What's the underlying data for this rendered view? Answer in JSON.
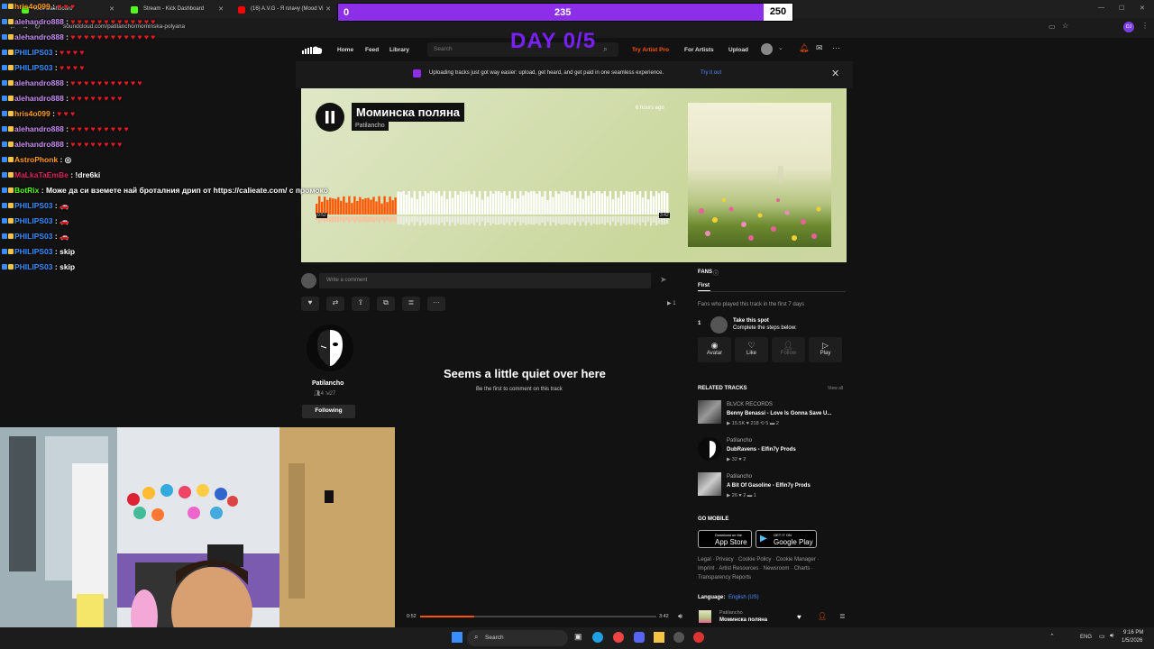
{
  "browser": {
    "tabs": [
      {
        "label": "Kick Dashboard",
        "color": "#53fc18"
      },
      {
        "label": "Stream - Kick Dashboard",
        "color": "#53fc18"
      },
      {
        "label": "(16) A.V.G - Я плачу (Mood Vi",
        "color": "#ff0000"
      }
    ],
    "url": "soundcloud.com/patilancho/mominska-polyana",
    "profile_initials": "DJ"
  },
  "overlay": {
    "poll_left": "0",
    "poll_mid": "235",
    "poll_right": "250",
    "day": "DAY 0/5"
  },
  "nav": {
    "home": "Home",
    "feed": "Feed",
    "library": "Library",
    "search_placeholder": "Search",
    "try_pro": "Try Artist Pro",
    "for_artists": "For Artists",
    "upload": "Upload"
  },
  "banner": {
    "text": "Uploading tracks just got way easier: upload, get heard, and get paid in one seamless experience.",
    "link": "Try it out"
  },
  "track": {
    "title": "Моминска поляна",
    "artist": "Patilancho",
    "posted": "6 hours ago",
    "elapsed": "0:52",
    "duration": "3:42",
    "progress": 0.23
  },
  "comment": {
    "placeholder": "Write a comment"
  },
  "plays_count": "1",
  "profile": {
    "name": "Patilancho",
    "followers": "4",
    "following_count": "27",
    "follow_button": "Following"
  },
  "quiet": {
    "title": "Seems a little quiet over here",
    "subtitle": "Be the first to comment on this track"
  },
  "fans": {
    "heading": "FANS",
    "tab": "First",
    "description": "Fans who played this track in the first 7 days",
    "rank": "1",
    "spot_title": "Take this spot",
    "spot_sub": "Complete the steps below:",
    "buttons": [
      "Avatar",
      "Like",
      "Follow",
      "Play"
    ]
  },
  "related": {
    "heading": "RELATED TRACKS",
    "view_all": "View all",
    "items": [
      {
        "artist": "BLVCK RECORDS",
        "title": "Benny Benassi - Love Is Gonna Save U...",
        "stats": "▶ 15.5K  ♥ 218  ⟲ 5  ▬ 2"
      },
      {
        "artist": "Patilancho",
        "title": "DubRavens - Elfin7y Prods",
        "stats": "▶ 32  ♥ 2"
      },
      {
        "artist": "Patilancho",
        "title": "A Bit Of Gasoline - Elfin7y Prods",
        "stats": "▶ 26  ♥ 2  ▬ 1"
      }
    ]
  },
  "mobile": {
    "heading": "GO MOBILE",
    "appstore_small": "Download on the",
    "appstore": "App Store",
    "gplay_small": "GET IT ON",
    "gplay": "Google Play"
  },
  "footer": {
    "line1": "Legal · Privacy · Cookie Policy · Cookie Manager ·",
    "line2": "Imprint · Artist Resources · Newsroom · Charts ·",
    "line3": "Transparency Reports",
    "language_label": "Language:",
    "language_value": "English (US)"
  },
  "player": {
    "elapsed": "0:52",
    "duration": "3:42",
    "artist": "Patilancho",
    "title": "Моминска поляна"
  },
  "chat": [
    {
      "user": "hris4o099",
      "color": "#ff9a1f",
      "msg": "",
      "hearts": "♥ ♥ ♥"
    },
    {
      "user": "alehandro888",
      "color": "#c58cf0",
      "msg": "",
      "hearts": "♥ ♥ ♥ ♥ ♥ ♥ ♥ ♥ ♥ ♥ ♥ ♥ ♥"
    },
    {
      "user": "alehandro888",
      "color": "#c58cf0",
      "msg": "",
      "hearts": "♥ ♥ ♥ ♥ ♥ ♥ ♥ ♥ ♥ ♥ ♥ ♥ ♥"
    },
    {
      "user": "PHILIPS03",
      "color": "#3a8dff",
      "msg": "",
      "hearts": "♥ ♥ ♥ ♥"
    },
    {
      "user": "PHILIPS03",
      "color": "#3a8dff",
      "msg": "",
      "hearts": "♥ ♥ ♥ ♥"
    },
    {
      "user": "alehandro888",
      "color": "#c58cf0",
      "msg": "",
      "hearts": "♥ ♥ ♥ ♥ ♥ ♥ ♥ ♥ ♥ ♥ ♥"
    },
    {
      "user": "alehandro888",
      "color": "#c58cf0",
      "msg": "",
      "hearts": "♥ ♥ ♥ ♥ ♥ ♥ ♥ ♥"
    },
    {
      "user": "hris4o099",
      "color": "#ff9a1f",
      "msg": "",
      "hearts": "♥ ♥ ♥"
    },
    {
      "user": "alehandro888",
      "color": "#c58cf0",
      "msg": "",
      "hearts": "♥ ♥ ♥ ♥ ♥ ♥ ♥ ♥ ♥"
    },
    {
      "user": "alehandro888",
      "color": "#c58cf0",
      "msg": "",
      "hearts": "♥ ♥ ♥ ♥ ♥ ♥ ♥ ♥"
    },
    {
      "user": "AstroPhonk",
      "color": "#ff9a1f",
      "msg": "◎",
      "hearts": ""
    },
    {
      "user": "MaLkaTaEmBe",
      "color": "#e0245e",
      "msg": "!dre6ki",
      "hearts": ""
    },
    {
      "user": "BotRix",
      "color": "#53fc18",
      "msg": "Може да си вземете най броталния дрип от https://calieate.com/ с промоко",
      "hearts": ""
    },
    {
      "user": "PHILIPS03",
      "color": "#3a8dff",
      "msg": "🚗",
      "hearts": ""
    },
    {
      "user": "PHILIPS03",
      "color": "#3a8dff",
      "msg": "🚗",
      "hearts": ""
    },
    {
      "user": "PHILIPS03",
      "color": "#3a8dff",
      "msg": "🚗",
      "hearts": ""
    },
    {
      "user": "PHILIPS03",
      "color": "#3a8dff",
      "msg": "skip",
      "hearts": ""
    },
    {
      "user": "PHILIPS03",
      "color": "#3a8dff",
      "msg": "skip",
      "hearts": ""
    }
  ],
  "taskbar": {
    "search": "Search",
    "lang": "ENG",
    "time": "9:16 PM",
    "date": "1/5/2026"
  }
}
